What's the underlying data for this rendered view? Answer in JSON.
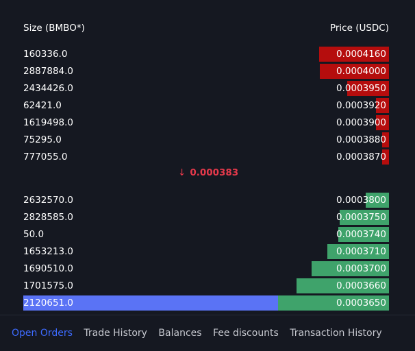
{
  "header": {
    "size_label": "Size (BMBO*)",
    "price_label": "Price (USDC)"
  },
  "asks": [
    {
      "size": "160336.0",
      "price": "0.0004160",
      "depth_pct": 19.1
    },
    {
      "size": "2887884.0",
      "price": "0.0004000",
      "depth_pct": 18.9
    },
    {
      "size": "2434426.0",
      "price": "0.0003950",
      "depth_pct": 11.4
    },
    {
      "size": "62421.0",
      "price": "0.0003920",
      "depth_pct": 3.6
    },
    {
      "size": "1619498.0",
      "price": "0.0003900",
      "depth_pct": 3.6
    },
    {
      "size": "75295.0",
      "price": "0.0003880",
      "depth_pct": 1.9
    },
    {
      "size": "777055.0",
      "price": "0.0003870",
      "depth_pct": 1.9
    }
  ],
  "spread": {
    "direction_icon": "arrow-down-icon",
    "value": "0.000383",
    "color": "#e5394b"
  },
  "bids": [
    {
      "size": "2632570.0",
      "price": "0.0003800",
      "depth_pct": 6.4
    },
    {
      "size": "2828585.0",
      "price": "0.0003750",
      "depth_pct": 13.5
    },
    {
      "size": "50.0",
      "price": "0.0003740",
      "depth_pct": 13.9
    },
    {
      "size": "1653213.0",
      "price": "0.0003710",
      "depth_pct": 16.9
    },
    {
      "size": "1690510.0",
      "price": "0.0003700",
      "depth_pct": 21.2
    },
    {
      "size": "1701575.0",
      "price": "0.0003660",
      "depth_pct": 25.3
    },
    {
      "size": "2120651.0",
      "price": "0.0003650",
      "depth_pct": 30.3,
      "selected": true
    }
  ],
  "colors": {
    "ask": "#b50d0d",
    "bid": "#3fa36b",
    "selected": "#5a73f5",
    "active_tab": "#3d6bff"
  },
  "tabs": [
    {
      "label": "Open Orders",
      "active": true
    },
    {
      "label": "Trade History",
      "active": false
    },
    {
      "label": "Balances",
      "active": false
    },
    {
      "label": "Fee discounts",
      "active": false
    },
    {
      "label": "Transaction History",
      "active": false
    }
  ]
}
